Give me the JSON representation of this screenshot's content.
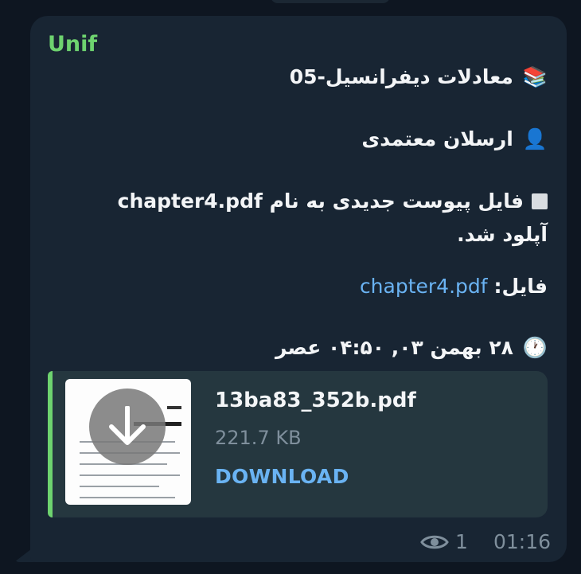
{
  "message": {
    "sender": "Unif",
    "course_emoji": "📚",
    "course_title": "معادلات دیفرانسیل-05",
    "author_emoji": "👤",
    "author_name": "ارسلان معتمدی",
    "notice_text": "فایل پیوست جدیدی به نام chapter4.pdf آپلود شد.",
    "file_label": "فایل:",
    "file_link": "chapter4.pdf",
    "clock_emoji": "🕐",
    "date_text": "۲۸ بهمن ۰۳, ۰۴:۵۰ عصر",
    "attachment": {
      "filename": "13ba83_352b.pdf",
      "size": "221.7 KB",
      "action": "DOWNLOAD"
    },
    "views": "1",
    "time": "01:16"
  },
  "colors": {
    "background": "#0e1621",
    "bubble": "#182533",
    "sender": "#6ed36f",
    "link": "#6ab3f3",
    "meta": "#7f8f9c"
  },
  "icons": [
    "books-emoji",
    "person-silhouette-emoji",
    "white-square-icon",
    "clock-emoji",
    "download-arrow-icon",
    "eye-icon"
  ]
}
